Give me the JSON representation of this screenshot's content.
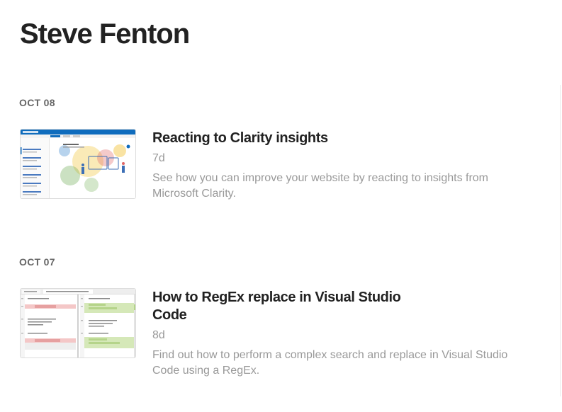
{
  "site": {
    "title": "Steve Fenton"
  },
  "groups": [
    {
      "date": "OCT 08",
      "post": {
        "title": "Reacting to Clarity insights",
        "age": "7d",
        "description": "See how you can improve your website by reacting to insights from Microsoft Clarity.",
        "thumbnail": "clarity-heatmap-screenshot"
      }
    },
    {
      "date": "OCT 07",
      "post": {
        "title": "How to RegEx replace in Visual Studio Code",
        "age": "8d",
        "description": "Find out how to perform a complex search and replace in Visual Studio Code using a RegEx.",
        "thumbnail": "vscode-diff-screenshot"
      }
    }
  ],
  "colors": {
    "title": "#222222",
    "muted": "#999999",
    "date": "#666666",
    "clarity_blue": "#0f6cbd",
    "diff_removed": "#f4c7c7",
    "diff_added": "#d5e8b8"
  }
}
